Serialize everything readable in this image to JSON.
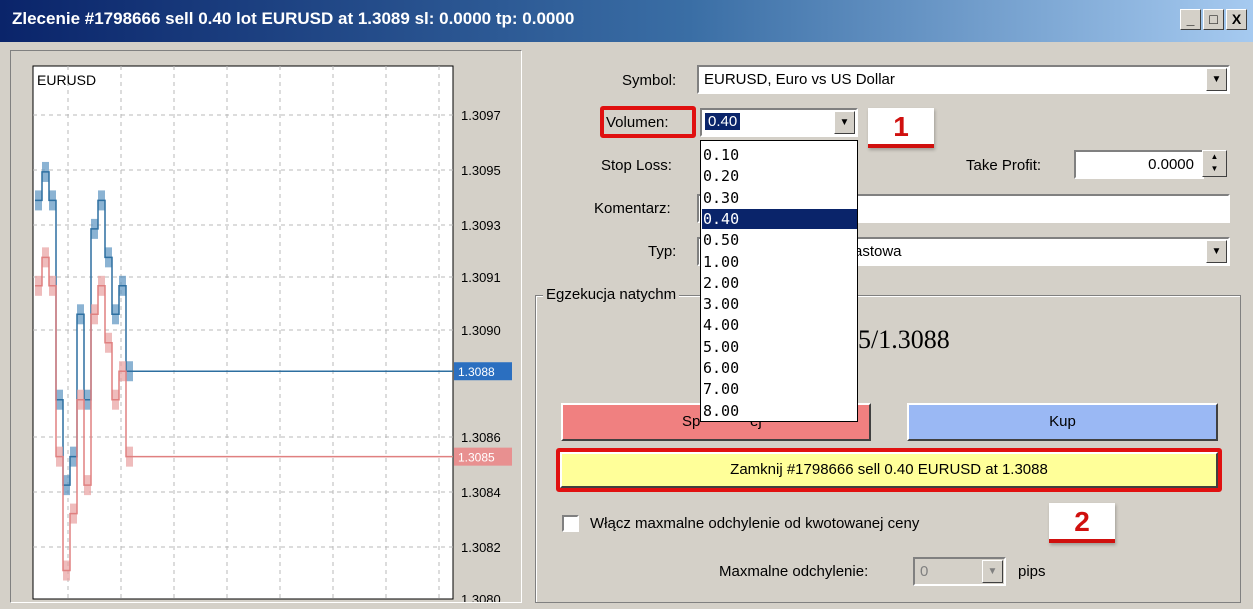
{
  "window": {
    "title": "Zlecenie #1798666 sell 0.40 lot EURUSD at 1.3089 sl: 0.0000 tp: 0.0000",
    "buttons": [
      "_",
      "□",
      "X"
    ]
  },
  "chart_data": {
    "type": "line",
    "title": "EURUSD",
    "xlabel": "",
    "ylabel": "",
    "y_ticks": [
      "1.3097",
      "1.3095",
      "1.3093",
      "1.3091",
      "1.3090",
      "1.3086",
      "1.3084",
      "1.3082",
      "1.3080"
    ],
    "ask_label": "1.3088",
    "bid_label": "1.3085",
    "grid": true,
    "series": [
      {
        "color": "#5a93c0",
        "values": [
          1.3094,
          1.3095,
          1.3094,
          1.3087,
          1.3084,
          1.3085,
          1.309,
          1.3087,
          1.3093,
          1.3094,
          1.3092,
          1.309,
          1.3091,
          1.3088
        ]
      },
      {
        "color": "#e8a0a0",
        "values": [
          1.3091,
          1.3092,
          1.3091,
          1.3085,
          1.3081,
          1.3083,
          1.3087,
          1.3084,
          1.309,
          1.3091,
          1.3089,
          1.3087,
          1.3088,
          1.3085
        ]
      }
    ]
  },
  "form": {
    "symbol_label": "Symbol:",
    "symbol_value": "EURUSD, Euro vs US Dollar",
    "volume_label": "Volumen:",
    "volume_value": "0.40",
    "stoploss_label": "Stop Loss:",
    "takeprofit_label": "Take Profit:",
    "takeprofit_value": "0.0000",
    "comment_label": "Komentarz:",
    "type_label": "Typ:",
    "type_value_partial": "astowa",
    "volume_options": [
      "0.10",
      "0.20",
      "0.30",
      "0.40",
      "0.50",
      "1.00",
      "2.00",
      "3.00",
      "4.00",
      "5.00",
      "6.00",
      "7.00",
      "8.00"
    ],
    "volume_selected_index": 3
  },
  "execution": {
    "group_caption_partial": "Egzekucja natychm",
    "quote_partial": "35/1.3088",
    "sell_partial_left": "Sp",
    "sell_partial_right": "ej",
    "buy_label": "Kup",
    "close_label": "Zamknij #1798666 sell 0.40 EURUSD at 1.3088",
    "deviation_checkbox_label": "Włącz maxmalne odchylenie od kwotowanej ceny",
    "deviation_label": "Maxmalne odchylenie:",
    "deviation_value": "0",
    "pips_label": "pips"
  },
  "annotations": {
    "badge1": "1",
    "badge2": "2"
  },
  "colors": {
    "sell": "#f08080",
    "buy": "#9ab8f4",
    "close": "#ffff99",
    "annotation": "#e01010",
    "ask_line": "#2d6fa0",
    "bid_line": "#e08080"
  }
}
